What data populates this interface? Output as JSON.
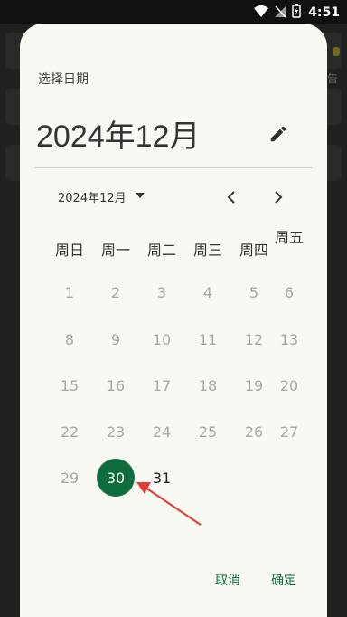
{
  "status_bar": {
    "time": "4:51"
  },
  "background": {
    "snippet": "告"
  },
  "dialog": {
    "label": "选择日期",
    "headline": "2024年12月",
    "month_picker": "2024年12月"
  },
  "weekdays": [
    "周日",
    "周一",
    "周二",
    "周三",
    "周四",
    "周五"
  ],
  "days": [
    "1",
    "2",
    "3",
    "4",
    "5",
    "6",
    "8",
    "9",
    "10",
    "11",
    "12",
    "13",
    "15",
    "16",
    "17",
    "18",
    "19",
    "20",
    "22",
    "23",
    "24",
    "25",
    "26",
    "27",
    "29",
    "30",
    "31"
  ],
  "selected_day": "30",
  "actions": {
    "cancel": "取消",
    "ok": "确定"
  },
  "colors": {
    "accent": "#0f6c3c",
    "arrow": "#e53935"
  }
}
